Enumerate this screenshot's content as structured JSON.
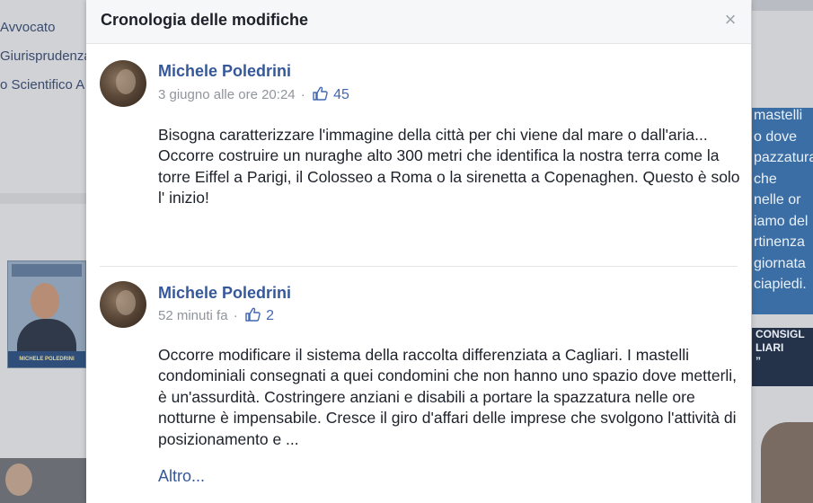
{
  "background": {
    "left_links": [
      "Avvocato",
      "Giurisprudenza",
      "o Scientifico A"
    ],
    "poster_name": "MICHELE POLEDRINI",
    "right_blue_lines": [
      "mastelli",
      "o dove",
      "pazzatura",
      "che",
      "nelle or",
      "iamo del",
      "rtinenza",
      "giornata",
      "ciapiedi."
    ],
    "right_dark_lines": [
      "CONSIGL",
      "LIARI",
      "”"
    ]
  },
  "modal": {
    "title": "Cronologia delle modifiche",
    "close_glyph": "×"
  },
  "posts": [
    {
      "author": "Michele Poledrini",
      "time": "3 giugno alle ore 20:24",
      "likes": "45",
      "paragraphs": [
        "Bisogna caratterizzare l'immagine della città per chi viene dal mare o dall'aria...",
        "Occorre costruire un nuraghe alto 300 metri che identifica la nostra terra come la torre Eiffel a Parigi, il Colosseo a Roma o la sirenetta a Copenaghen. Questo è solo l' inizio!"
      ]
    },
    {
      "author": "Michele Poledrini",
      "time": "52 minuti fa",
      "likes": "2",
      "paragraphs": [
        "Occorre modificare il sistema della raccolta differenziata a Cagliari. I mastelli condominiali consegnati a quei condomini che non hanno uno spazio dove metterli, è un'assurdità. Costringere anziani e disabili a portare la spazzatura nelle ore notturne è impensabile. Cresce il giro d'affari delle imprese che svolgono l'attività di posizionamento e ..."
      ],
      "more_label": "Altro..."
    }
  ],
  "colors": {
    "link": "#365899",
    "meta": "#90949c",
    "text": "#1d2129"
  }
}
